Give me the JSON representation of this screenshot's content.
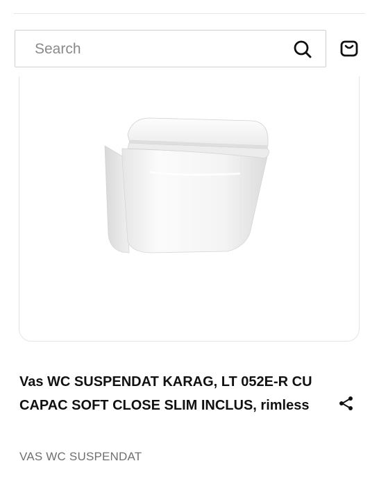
{
  "search": {
    "placeholder": "Search",
    "value": "",
    "icon": "search-icon"
  },
  "header": {
    "cart_icon": "shopping-bag-icon"
  },
  "product": {
    "image_alt": "wall-hung toilet with slim soft-close seat",
    "title": "Vas WC SUSPENDAT KARAG, LT 052E-R CU CAPAC SOFT CLOSE SLIM INCLUS, rimless",
    "category": "VAS WC SUSPENDAT",
    "share_icon": "share-icon"
  },
  "colors": {
    "text": "#111111",
    "muted": "#6f6f6f",
    "border": "#cfcfcf",
    "card_border": "#e4e4e4"
  }
}
